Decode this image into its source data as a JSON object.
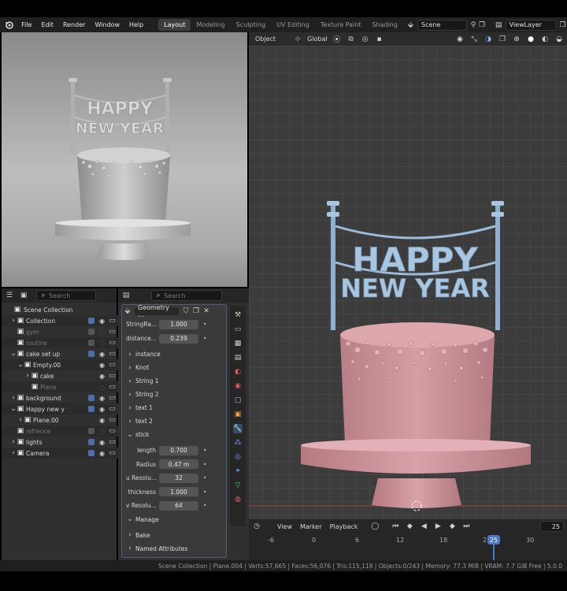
{
  "menu": [
    "File",
    "Edit",
    "Render",
    "Window",
    "Help"
  ],
  "workspaces": [
    "Layout",
    "Modeling",
    "Sculpting",
    "UV Editing",
    "Texture Paint",
    "Shading"
  ],
  "scene_name": "Scene",
  "view_layer": "ViewLayer",
  "viewport_header": {
    "mode": "Object",
    "orientation": "Global"
  },
  "render_preview": {
    "top_text": "HAPPY",
    "bottom_text": "NEW YEAR"
  },
  "viewport_model": {
    "top_text": "HAPPY",
    "bottom_text": "NEW YEAR"
  },
  "outliner": {
    "search_placeholder": "Search",
    "root": "Scene Collection",
    "items": [
      {
        "label": "Collection",
        "indent": 1,
        "expanded": false,
        "checked": true,
        "visible": true
      },
      {
        "label": "gym",
        "indent": 1,
        "expanded": null,
        "checked": false,
        "visible": false,
        "dim": true
      },
      {
        "label": "routine",
        "indent": 1,
        "expanded": null,
        "checked": false,
        "visible": false,
        "dim": true
      },
      {
        "label": "cake set up",
        "indent": 1,
        "expanded": true,
        "checked": true,
        "visible": true
      },
      {
        "label": "Empty.00",
        "indent": 2,
        "expanded": true,
        "checked": null,
        "visible": true
      },
      {
        "label": "cake",
        "indent": 3,
        "expanded": false,
        "checked": null,
        "visible": true
      },
      {
        "label": "Plane",
        "indent": 3,
        "expanded": null,
        "checked": null,
        "visible": false,
        "dim": true
      },
      {
        "label": "background",
        "indent": 1,
        "expanded": false,
        "checked": true,
        "visible": true
      },
      {
        "label": "Happy new y",
        "indent": 1,
        "expanded": true,
        "checked": true,
        "visible": true
      },
      {
        "label": "Plane.00",
        "indent": 2,
        "expanded": false,
        "checked": null,
        "visible": true
      },
      {
        "label": "refrence",
        "indent": 1,
        "expanded": null,
        "checked": false,
        "visible": false,
        "dim": true
      },
      {
        "label": "lights",
        "indent": 1,
        "expanded": false,
        "checked": true,
        "visible": true
      },
      {
        "label": "Camera",
        "indent": 1,
        "expanded": false,
        "checked": true,
        "visible": true
      }
    ]
  },
  "properties": {
    "search_placeholder": "Search",
    "modifier_name": "Geometry ...",
    "fields": [
      {
        "label": "StringRa...",
        "value": "1.000"
      },
      {
        "label": "distance...",
        "value": "0.239"
      }
    ],
    "sections": [
      "instance",
      "Knot",
      "String 1",
      "String 2",
      "text 1",
      "text 2"
    ],
    "stick_label": "stick",
    "stick_fields": [
      {
        "label": "length",
        "value": "0.700"
      },
      {
        "label": "Radius",
        "value": "0.47 m"
      },
      {
        "label": "u Resolu...",
        "value": "32"
      },
      {
        "label": "thickness",
        "value": "1.000"
      },
      {
        "label": "v Resolu...",
        "value": "64"
      }
    ],
    "manage_label": "Manage",
    "bottom_sections": [
      "Bake",
      "Named Attributes"
    ]
  },
  "timeline": {
    "menus": [
      "View",
      "Marker",
      "Playback"
    ],
    "current_frame": "25",
    "ticks": [
      "-6",
      "0",
      "6",
      "12",
      "18",
      "2",
      "30"
    ],
    "playhead_label": "25"
  },
  "statusbar": "Scene Collection | Plane.004 | Verts:57,665 | Faces:56,076 | Tris:115,118 | Objects:0/243 | Memory: 77.3 MiB | VRAM: 7.7 GiB Free | 5.0.0"
}
